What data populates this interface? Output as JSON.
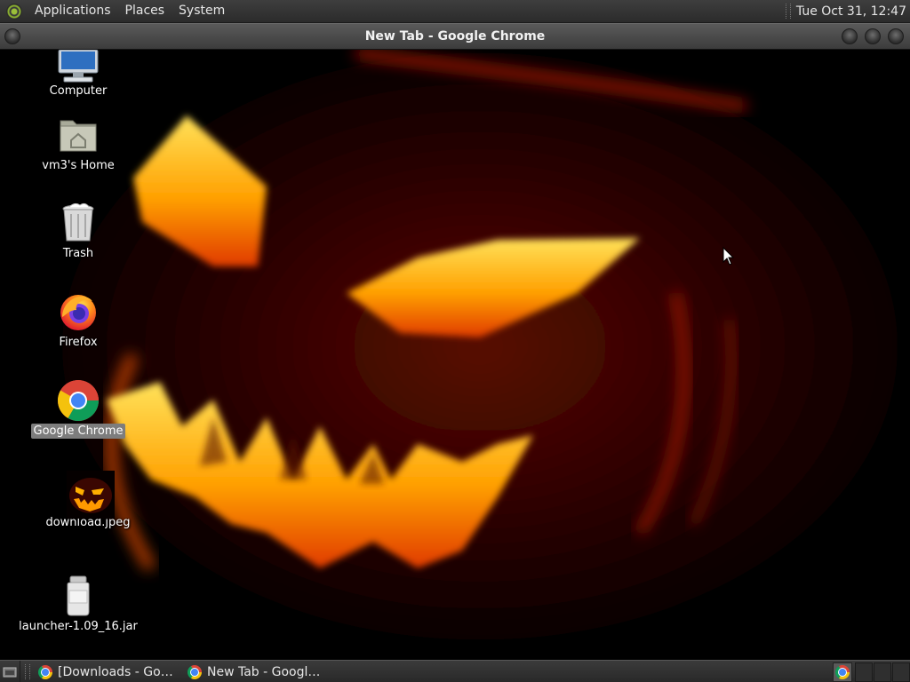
{
  "top_panel": {
    "menus": [
      "Applications",
      "Places",
      "System"
    ],
    "clock": "Tue Oct 31, 12:47"
  },
  "window": {
    "title": "New Tab - Google Chrome"
  },
  "desktop": {
    "icons": [
      {
        "label": "Computer",
        "icon": "computer-icon"
      },
      {
        "label": "vm3's Home",
        "icon": "home-folder-icon"
      },
      {
        "label": "Trash",
        "icon": "trash-icon"
      },
      {
        "label": "Firefox",
        "icon": "firefox-icon"
      },
      {
        "label": "Google Chrome",
        "icon": "chrome-icon",
        "selected": true
      },
      {
        "label": "download.jpeg",
        "icon": "jack-o-lantern-thumbnail-icon"
      },
      {
        "label": "launcher-1.09_16.jar",
        "icon": "jar-icon"
      }
    ]
  },
  "taskbar": {
    "tasks": [
      {
        "label": "[Downloads - Goog...",
        "icon": "chrome-icon"
      },
      {
        "label": "New Tab - Google C...",
        "icon": "chrome-icon"
      }
    ],
    "tray_icon": "chrome-icon"
  },
  "colors": {
    "panel": "#2b2b2b",
    "selection": "#7d7d7d",
    "wallpaper_glow": "#ffb000",
    "wallpaper_red": "#c01a10"
  }
}
